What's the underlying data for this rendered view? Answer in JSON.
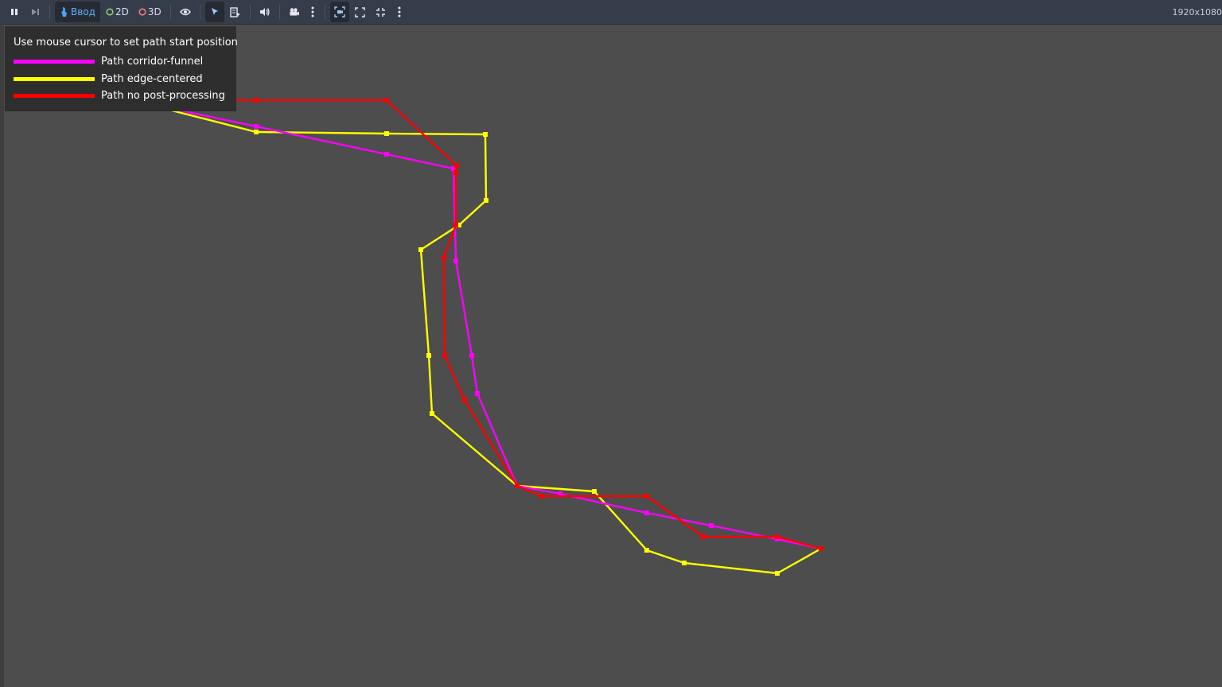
{
  "toolbar": {
    "input_label": "Ввод",
    "label_2d": "2D",
    "label_3d": "3D",
    "icons": [
      "pause-icon",
      "step-forward-icon",
      "input-pointer-icon",
      "node-2d-icon",
      "node-3d-icon",
      "visibility-eye-icon",
      "select-arrow-icon",
      "list-select-icon",
      "audio-speaker-icon",
      "camera-icon",
      "more-vertical-icon",
      "camera-override-icon",
      "fullscreen-expand-icon",
      "fullscreen-collapse-icon",
      "more-vertical-icon"
    ]
  },
  "resolution": "1920x1080",
  "legend": {
    "title": "Use mouse cursor to set path start position",
    "items": [
      {
        "label": "Path corridor-funnel",
        "color": "#ff00ff"
      },
      {
        "label": "Path edge-centered",
        "color": "#ffff00"
      },
      {
        "label": "Path no post-processing",
        "color": "#ff0000"
      }
    ]
  },
  "colors": {
    "background": "#4d4d4d",
    "toolbar": "#363d4a",
    "accent": "#4aa3ff"
  },
  "paths": [
    {
      "id": "path-edge-centered",
      "color": "#ffff00",
      "points": [
        [
          165,
          126
        ],
        [
          322,
          166
        ],
        [
          486,
          168
        ],
        [
          610,
          169
        ],
        [
          611,
          252
        ],
        [
          577,
          283
        ],
        [
          529,
          314
        ],
        [
          539,
          447
        ],
        [
          543,
          520
        ],
        [
          650,
          611
        ],
        [
          747,
          618
        ],
        [
          813,
          692
        ],
        [
          860,
          708
        ],
        [
          977,
          721
        ],
        [
          1032,
          690
        ]
      ]
    },
    {
      "id": "path-corridor-funnel",
      "color": "#ff00ff",
      "points": [
        [
          165,
          126
        ],
        [
          322,
          159
        ],
        [
          486,
          194
        ],
        [
          570,
          212
        ],
        [
          573,
          328
        ],
        [
          593,
          447
        ],
        [
          600,
          495
        ],
        [
          650,
          611
        ],
        [
          704,
          621
        ],
        [
          813,
          645
        ],
        [
          894,
          661
        ],
        [
          977,
          678
        ],
        [
          1032,
          690
        ]
      ]
    },
    {
      "id": "path-no-post-processing",
      "color": "#ff0000",
      "points": [
        [
          165,
          126
        ],
        [
          322,
          126
        ],
        [
          486,
          126
        ],
        [
          574,
          208
        ],
        [
          573,
          217
        ],
        [
          573,
          283
        ],
        [
          558,
          324
        ],
        [
          559,
          447
        ],
        [
          584,
          503
        ],
        [
          650,
          611
        ],
        [
          681,
          624
        ],
        [
          813,
          624
        ],
        [
          884,
          675
        ],
        [
          977,
          675
        ],
        [
          1032,
          690
        ]
      ]
    }
  ]
}
